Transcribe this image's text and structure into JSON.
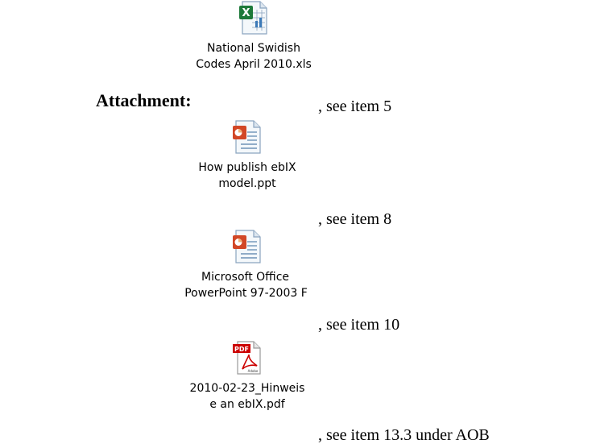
{
  "label": "Attachment:",
  "attachments": [
    {
      "icon": "excel-file-icon",
      "caption_lines": [
        "National Swidish",
        "Codes April 2010.xls"
      ],
      "ref": ", see item 5"
    },
    {
      "icon": "powerpoint-file-icon",
      "caption_lines": [
        "How publish ebIX",
        "model.ppt"
      ],
      "ref": ", see item 8"
    },
    {
      "icon": "powerpoint-file-icon",
      "caption_lines": [
        "Microsoft Office",
        "PowerPoint 97-2003 F"
      ],
      "ref": ", see item 10"
    },
    {
      "icon": "pdf-file-icon",
      "caption_lines": [
        "2010-02-23_Hinweis",
        "e an ebIX.pdf"
      ],
      "ref": ", see item 13.3 under AOB"
    }
  ],
  "colors": {
    "excel": "#1d7a3a",
    "powerpoint": "#d24726",
    "pdf": "#cc0000"
  }
}
